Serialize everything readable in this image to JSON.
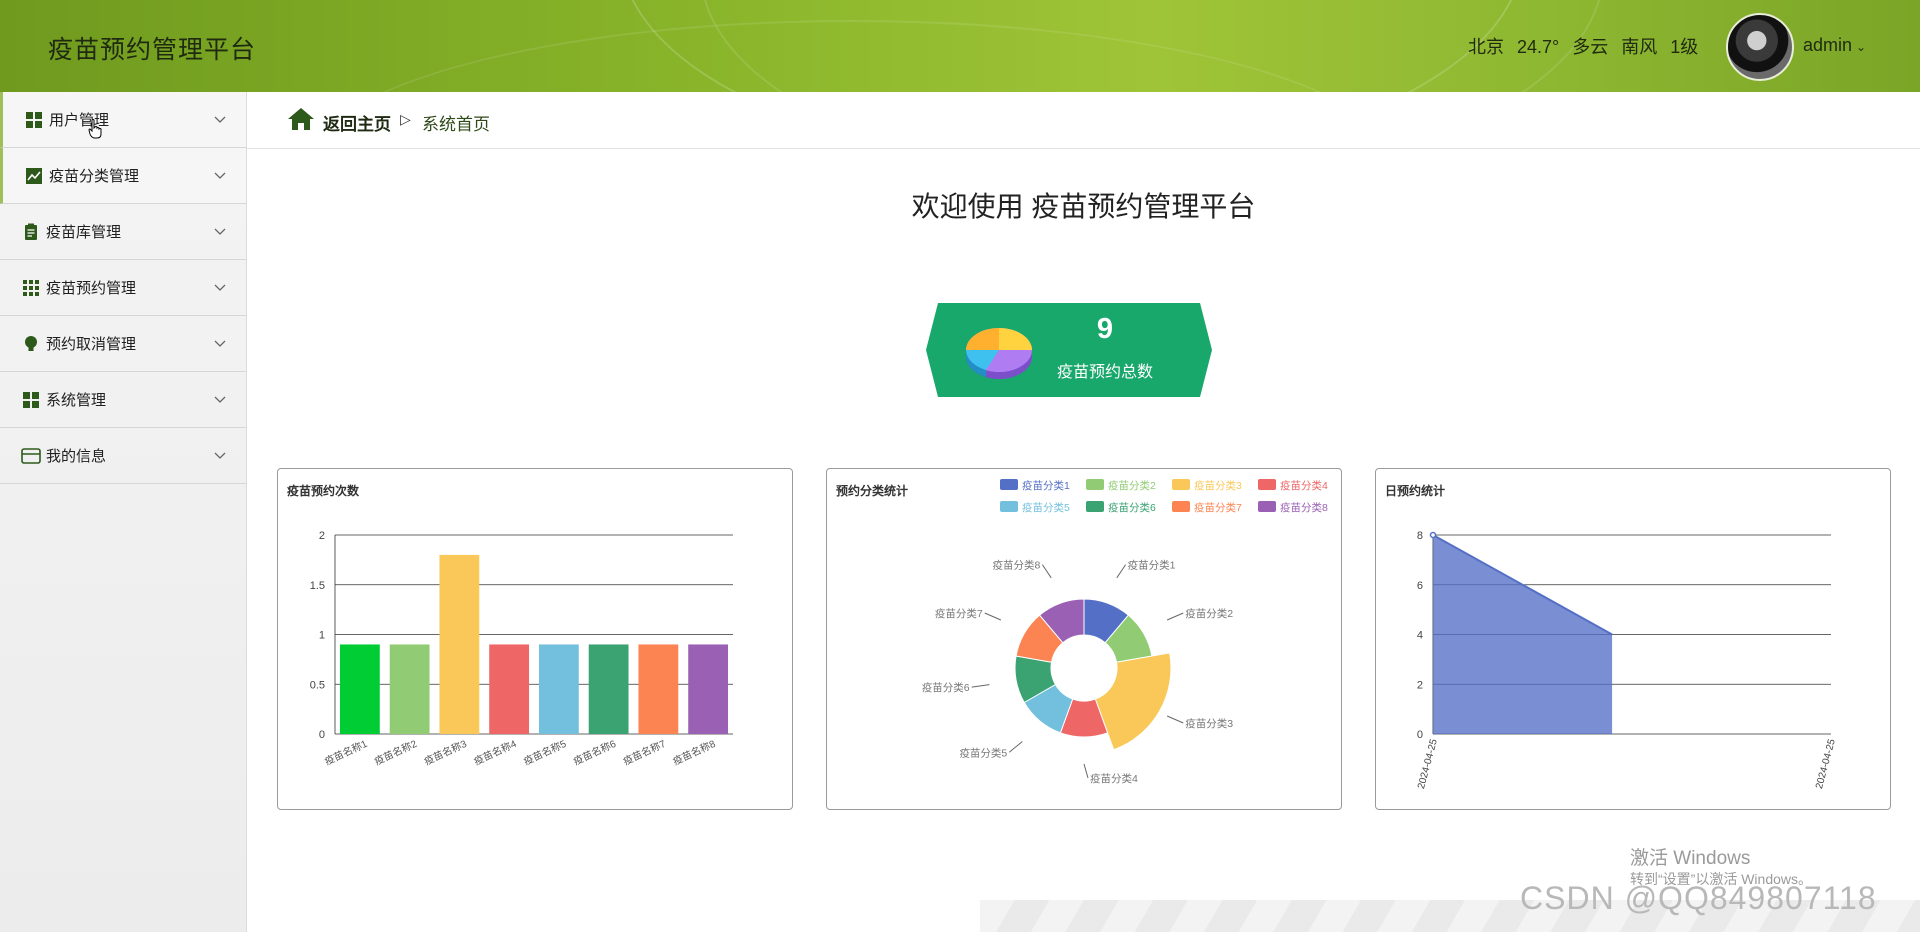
{
  "header": {
    "title": "疫苗预约管理平台",
    "weather": {
      "city": "北京",
      "temp": "24.7°",
      "condition": "多云",
      "wind": "南风",
      "level": "1级"
    },
    "user": "admin"
  },
  "sidebar": {
    "items": [
      {
        "label": "用户管理",
        "icon": "grid-icon"
      },
      {
        "label": "疫苗分类管理",
        "icon": "chart-icon"
      },
      {
        "label": "疫苗库管理",
        "icon": "clipboard-icon"
      },
      {
        "label": "疫苗预约管理",
        "icon": "apps-icon"
      },
      {
        "label": "预约取消管理",
        "icon": "bulb-icon"
      },
      {
        "label": "系统管理",
        "icon": "grid-icon"
      },
      {
        "label": "我的信息",
        "icon": "card-icon"
      }
    ]
  },
  "breadcrumb": {
    "back": "返回主页",
    "separator": "▷",
    "current": "系统首页"
  },
  "welcome": "欢迎使用 疫苗预约管理平台",
  "stat": {
    "value": "9",
    "label": "疫苗预约总数"
  },
  "colors": {
    "header": "#88b42a",
    "stat_card": "#19a86b",
    "series": [
      "#5470c6",
      "#91cc75",
      "#fac858",
      "#ee6666",
      "#73c0de",
      "#3ba272",
      "#fc8452",
      "#9a60b4"
    ],
    "bar_first": "#00cc33"
  },
  "chart_data": [
    {
      "type": "bar",
      "title": "疫苗预约次数",
      "categories": [
        "疫苗名称1",
        "疫苗名称2",
        "疫苗名称3",
        "疫苗名称4",
        "疫苗名称5",
        "疫苗名称6",
        "疫苗名称7",
        "疫苗名称8"
      ],
      "values": [
        1,
        1,
        2,
        1,
        1,
        1,
        1,
        1
      ],
      "ylim": [
        0,
        2
      ],
      "yticks": [
        "0",
        "0.5",
        "1",
        "1.5",
        "2"
      ],
      "grid": true
    },
    {
      "type": "pie",
      "title": "预约分类统计",
      "legend_position": "top-right",
      "categories": [
        "疫苗分类1",
        "疫苗分类2",
        "疫苗分类3",
        "疫苗分类4",
        "疫苗分类5",
        "疫苗分类6",
        "疫苗分类7",
        "疫苗分类8"
      ],
      "values": [
        1,
        1,
        2,
        1,
        1,
        1,
        1,
        1
      ],
      "rose": true
    },
    {
      "type": "area",
      "title": "日预约统计",
      "x": [
        "2024-04-25",
        "2024-04-25"
      ],
      "values": [
        8,
        4
      ],
      "ylim": [
        0,
        8
      ],
      "yticks": [
        "0",
        "2",
        "4",
        "6",
        "8"
      ],
      "grid": true
    }
  ],
  "watermark": {
    "activate": "激活 Windows",
    "activate_hint": "转到“设置”以激活 Windows。",
    "csdn": "CSDN @QQ849807118"
  }
}
